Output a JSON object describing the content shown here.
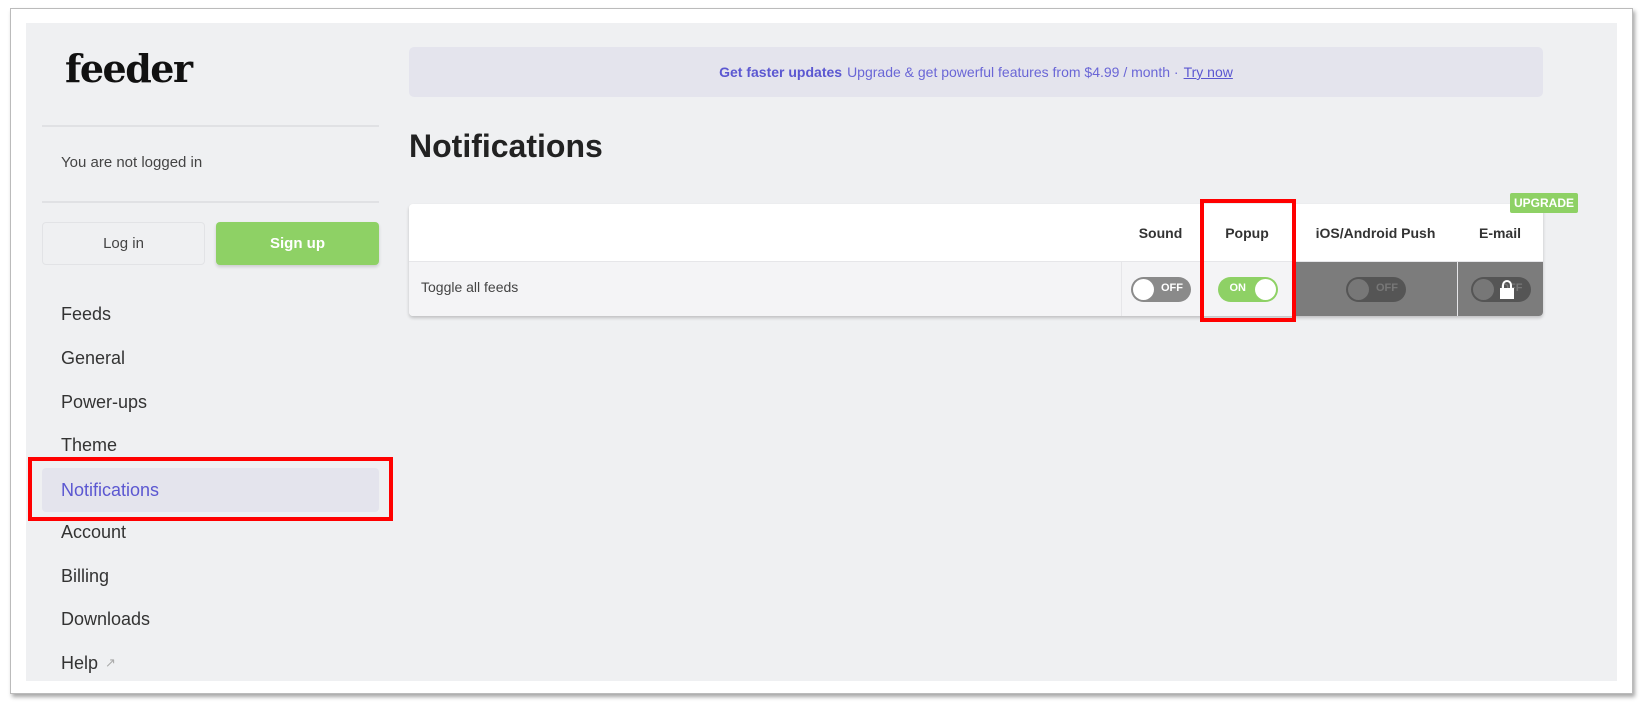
{
  "logo": "feeder",
  "sidebar": {
    "status": "You are not logged in",
    "login": "Log in",
    "signup": "Sign up",
    "items": [
      {
        "label": "Feeds"
      },
      {
        "label": "General"
      },
      {
        "label": "Power-ups"
      },
      {
        "label": "Theme"
      },
      {
        "label": "Notifications"
      },
      {
        "label": "Account"
      },
      {
        "label": "Billing"
      },
      {
        "label": "Downloads"
      },
      {
        "label": "Help"
      }
    ]
  },
  "banner": {
    "bold": "Get faster updates",
    "text": "Upgrade & get powerful features from $4.99 / month ·",
    "link": "Try now"
  },
  "page_title": "Notifications",
  "table": {
    "columns": [
      "Sound",
      "Popup",
      "iOS/Android Push",
      "E-mail"
    ],
    "upgrade_badge": "UPGRADE",
    "row": {
      "label": "Toggle all feeds",
      "sound": "OFF",
      "popup": "ON",
      "push": "OFF",
      "email": "OFF"
    }
  }
}
